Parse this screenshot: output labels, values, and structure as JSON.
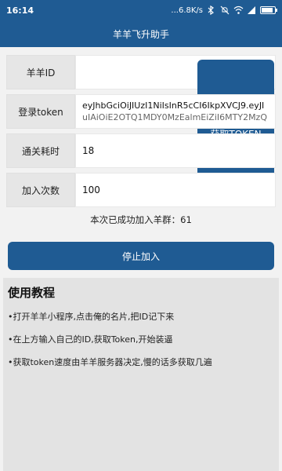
{
  "status_bar": {
    "time": "16:14",
    "network_speed": "...6.8K/s",
    "icons": [
      "bluetooth-icon",
      "mute-icon",
      "wifi-icon",
      "signal-icon",
      "battery-icon"
    ],
    "battery_level": 0.85
  },
  "app_bar": {
    "title": "羊羊飞升助手"
  },
  "form": {
    "id_label": "羊羊ID",
    "id_value": "",
    "get_token_label": "获取TOKEN",
    "token_label": "登录token",
    "token_value_line1": "eyJhbGciOiJIUzI1NiIsInR5cCI6IkpXVCJ9.eyJI",
    "token_value_line2": "uIAiOiE2OTQ1MDY0MzEalmEiZiI6MTY2MzQ",
    "time_label": "通关耗时",
    "time_value": "18",
    "times_label": "加入次数",
    "times_value": "100"
  },
  "result": {
    "success_text": "本次已成功加入羊群：61"
  },
  "stop_button_label": "停止加入",
  "tutorial": {
    "title": "使用教程",
    "steps": [
      "•打开羊羊小程序,点击俺的名片,把ID记下来",
      "•在上方输入自己的ID,获取Token,开始装逼",
      "•获取token速度由羊羊服务器决定,慢的话多获取几遍"
    ]
  },
  "colors": {
    "primary": "#1f5b93",
    "background": "#f2f2f2",
    "label_bg": "#e6e6e6",
    "panel_bg": "#e3e3e3"
  }
}
